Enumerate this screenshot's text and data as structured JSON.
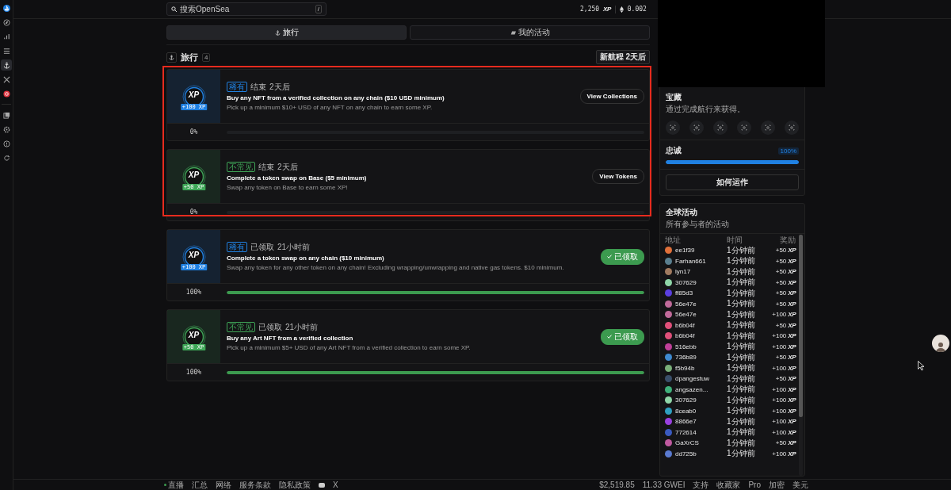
{
  "topbar": {
    "search": {
      "placeholder": "搜索OpenSea",
      "shortcut": "/"
    },
    "xp": "2,250",
    "xp_unit": "XP",
    "eth": "0.002"
  },
  "sidebar": {
    "items": [
      {
        "selected": false
      },
      {
        "selected": false
      },
      {
        "selected": false
      },
      {
        "selected": false
      },
      {
        "selected": true
      },
      {
        "selected": false
      },
      {
        "selected": false
      },
      {
        "selected": false
      },
      {
        "selected": false
      },
      {
        "selected": false
      },
      {
        "selected": false
      }
    ]
  },
  "tabs": [
    {
      "label": "旅行",
      "selected": true
    },
    {
      "label": "我的活动",
      "selected": false
    }
  ],
  "section": {
    "title": "旅行",
    "count": "4",
    "next": "新航程 2天后"
  },
  "quests": [
    {
      "color": "#2081e2",
      "logo": "XP",
      "reward": "+100 XP",
      "rarity": "稀有",
      "status": "结束",
      "when": "2天后",
      "title": "Buy any NFT from a verified collection on any chain ($10 USD minimum)",
      "description": "Pick up a minimum $10+ USD of any NFT on any chain to earn some XP.",
      "action": {
        "kind": "link",
        "label": "View Collections"
      },
      "level": 0,
      "reading": "0%",
      "highlighted": true
    },
    {
      "color": "#3fa657",
      "logo": "XP",
      "reward": "+50 XP",
      "rarity": "不常见",
      "status": "结束",
      "when": "2天后",
      "title": "Complete a token swap on Base ($5 minimum)",
      "description": "Swap any token on Base to earn some XP!",
      "action": {
        "kind": "link",
        "label": "View Tokens"
      },
      "level": 0,
      "reading": "0%",
      "highlighted": true
    },
    {
      "color": "#2081e2",
      "logo": "XP",
      "reward": "+100 XP",
      "rarity": "稀有",
      "status": "已领取",
      "when": "21小时前",
      "title": "Complete a token swap on any chain ($10 minimum)",
      "description": "Swap any token for any other token on any chain! Excluding wrapping/unwrapping and native gas tokens. $10 minimum.",
      "action": {
        "kind": "claimed",
        "label": "已领取"
      },
      "level": 1,
      "reading": "100%",
      "highlighted": false
    },
    {
      "color": "#3fa657",
      "logo": "XP",
      "reward": "+50 XP",
      "rarity": "不常见",
      "status": "已领取",
      "when": "21小时前",
      "title": "Buy any Art NFT from a verified collection",
      "description": "Pick up a minimum $5+ USD of any Art NFT from a verified collection to earn some XP.",
      "action": {
        "kind": "claimed",
        "label": "已领取"
      },
      "level": 1,
      "reading": "100%",
      "highlighted": false
    }
  ],
  "treasure": {
    "title": "宝藏",
    "subtitle": "通过完成航行来获得。",
    "badges": [
      {
        "earned": false
      },
      {
        "earned": false
      },
      {
        "earned": false
      },
      {
        "earned": false
      },
      {
        "earned": false
      },
      {
        "earned": false
      }
    ]
  },
  "loyalty": {
    "label": "忠诚",
    "reading": "100%",
    "level": 1
  },
  "how_button": "如何运作",
  "activity": {
    "title": "全球活动",
    "subtitle": "所有参与者的活动",
    "columns": [
      "地址",
      "时间",
      "奖励"
    ],
    "rows": [
      {
        "color": "#e0703a",
        "name": "ee1f39",
        "time": "1分钟前",
        "reward": "+50",
        "unit": "XP"
      },
      {
        "color": "#5a7f8f",
        "name": "Farhan661",
        "time": "1分钟前",
        "reward": "+50",
        "unit": "XP"
      },
      {
        "color": "#a07a60",
        "name": "lyn17",
        "time": "1分钟前",
        "reward": "+50",
        "unit": "XP"
      },
      {
        "color": "#8fd6a8",
        "name": "307629",
        "time": "1分钟前",
        "reward": "+50",
        "unit": "XP"
      },
      {
        "color": "#5a3fe0",
        "name": "ff85d3",
        "time": "1分钟前",
        "reward": "+50",
        "unit": "XP"
      },
      {
        "color": "#c06a9a",
        "name": "56e47e",
        "time": "1分钟前",
        "reward": "+50",
        "unit": "XP"
      },
      {
        "color": "#c06a9a",
        "name": "56e47e",
        "time": "1分钟前",
        "reward": "+100",
        "unit": "XP"
      },
      {
        "color": "#e0507a",
        "name": "b6b04f",
        "time": "1分钟前",
        "reward": "+50",
        "unit": "XP"
      },
      {
        "color": "#e0507a",
        "name": "b6b04f",
        "time": "1分钟前",
        "reward": "+100",
        "unit": "XP"
      },
      {
        "color": "#c0409a",
        "name": "516ebb",
        "time": "1分钟前",
        "reward": "+100",
        "unit": "XP"
      },
      {
        "color": "#3f8ad0",
        "name": "736b89",
        "time": "1分钟前",
        "reward": "+50",
        "unit": "XP"
      },
      {
        "color": "#7ab07a",
        "name": "f5b94b",
        "time": "1分钟前",
        "reward": "+100",
        "unit": "XP"
      },
      {
        "color": "#3a4f6a",
        "name": "dpangestuw",
        "time": "1分钟前",
        "reward": "+50",
        "unit": "XP"
      },
      {
        "color": "#3fb07a",
        "name": "angsazen...",
        "time": "1分钟前",
        "reward": "+100",
        "unit": "XP"
      },
      {
        "color": "#8fd6a8",
        "name": "307629",
        "time": "1分钟前",
        "reward": "+100",
        "unit": "XP"
      },
      {
        "color": "#2fa0c0",
        "name": "8ceab0",
        "time": "1分钟前",
        "reward": "+100",
        "unit": "XP"
      },
      {
        "color": "#9a40e0",
        "name": "8866e7",
        "time": "1分钟前",
        "reward": "+100",
        "unit": "XP"
      },
      {
        "color": "#3a5ac0",
        "name": "772614",
        "time": "1分钟前",
        "reward": "+100",
        "unit": "XP"
      },
      {
        "color": "#c05aa0",
        "name": "GaXrCS",
        "time": "1分钟前",
        "reward": "+50",
        "unit": "XP"
      },
      {
        "color": "#5a7ad0",
        "name": "dd725b",
        "time": "1分钟前",
        "reward": "+100",
        "unit": "XP"
      }
    ]
  },
  "footer": {
    "left": [
      {
        "kind": "live",
        "label": "直播"
      },
      {
        "kind": "text",
        "label": "汇总"
      },
      {
        "kind": "text",
        "label": "网络"
      },
      {
        "kind": "text",
        "label": "服务条款"
      },
      {
        "kind": "text",
        "label": "隐私政策"
      },
      {
        "kind": "discord"
      },
      {
        "kind": "text",
        "label": "X"
      }
    ],
    "right": [
      {
        "kind": "text",
        "label": "$2,519.85"
      },
      {
        "kind": "text",
        "label": "11.33 GWEI"
      },
      {
        "kind": "text",
        "label": "支持"
      },
      {
        "kind": "text",
        "label": "收藏家"
      },
      {
        "kind": "text",
        "label": "Pro"
      },
      {
        "kind": "text",
        "label": "加密"
      },
      {
        "kind": "text",
        "label": "美元"
      }
    ]
  }
}
